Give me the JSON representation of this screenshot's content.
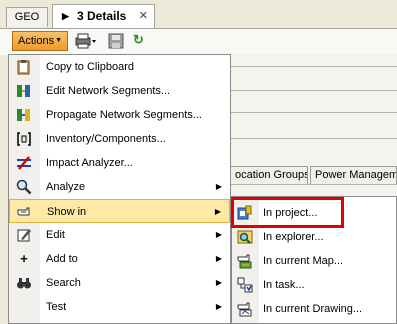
{
  "tabs": [
    {
      "label": "GEO"
    },
    {
      "label": "3 Details",
      "active": true
    }
  ],
  "toolbar": {
    "actions_label": "Actions",
    "icons": [
      "printer-icon",
      "save-icon",
      "refresh-icon"
    ]
  },
  "background_tabs": [
    {
      "label": "ocation Groups"
    },
    {
      "label": "Power Manageme"
    }
  ],
  "menu": {
    "items": [
      {
        "label": "Copy to Clipboard",
        "icon": "clipboard-icon"
      },
      {
        "label": "Edit Network Segments...",
        "icon": "network-segments-icon"
      },
      {
        "label": "Propagate Network Segments...",
        "icon": "propagate-icon"
      },
      {
        "label": "Inventory/Components...",
        "icon": "inventory-icon"
      },
      {
        "label": "Impact Analyzer...",
        "icon": "impact-analyzer-icon"
      },
      {
        "label": "Analyze",
        "icon": "magnifier-icon",
        "submenu": true
      },
      {
        "label": "Show in",
        "icon": "hand-pointer-icon",
        "submenu": true,
        "highlighted": true
      },
      {
        "label": "Edit",
        "icon": "edit-icon",
        "submenu": true
      },
      {
        "label": "Add to",
        "icon": "plus-icon",
        "submenu": true
      },
      {
        "label": "Search",
        "icon": "binoculars-icon",
        "submenu": true
      },
      {
        "label": "Test",
        "icon": "",
        "submenu": true
      }
    ]
  },
  "submenu": {
    "items": [
      {
        "label": "In project...",
        "icon": "project-icon"
      },
      {
        "label": "In explorer...",
        "icon": "explorer-icon"
      },
      {
        "label": "In current Map...",
        "icon": "map-icon"
      },
      {
        "label": "In task...",
        "icon": "task-icon"
      },
      {
        "label": "In current Drawing...",
        "icon": "drawing-icon"
      }
    ]
  },
  "colors": {
    "highlight_box": "#e00000",
    "actions_button": "#ef9b2d",
    "menu_hover": "#ffe9a6"
  }
}
